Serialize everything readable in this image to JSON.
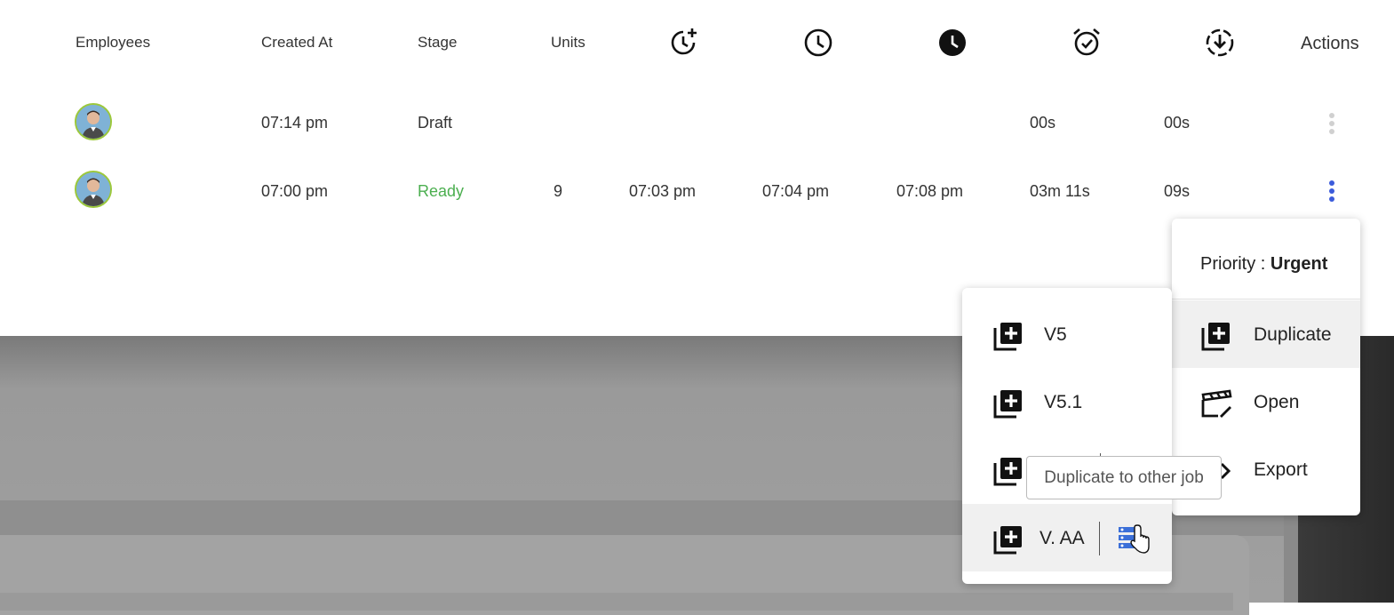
{
  "table": {
    "headers": {
      "employees": "Employees",
      "created_at": "Created At",
      "stage": "Stage",
      "units": "Units",
      "actions": "Actions"
    },
    "header_icons": [
      "clock-plus-icon",
      "clock-outline-icon",
      "clock-filled-icon",
      "alarm-clock-icon",
      "download-circle-icon"
    ],
    "rows": [
      {
        "created_at": "07:14 pm",
        "stage": "Draft",
        "units": "",
        "t1": "",
        "t2": "",
        "t3": "",
        "d1": "00s",
        "d2": "00s"
      },
      {
        "created_at": "07:00 pm",
        "stage": "Ready",
        "units": "9",
        "t1": "07:03 pm",
        "t2": "07:04 pm",
        "t3": "07:08 pm",
        "d1": "03m 11s",
        "d2": "09s"
      }
    ]
  },
  "actions_menu": {
    "priority_label": "Priority : ",
    "priority_value": "Urgent",
    "items": [
      {
        "label": "Duplicate",
        "icon": "library-add-icon"
      },
      {
        "label": "Open",
        "icon": "clapperboard-edit-icon"
      },
      {
        "label": "Export",
        "icon": "export-icon"
      }
    ]
  },
  "duplicate_submenu": {
    "items": [
      {
        "label": "V5",
        "icon": "library-add-icon"
      },
      {
        "label": "V5.1",
        "icon": "library-add-icon"
      },
      {
        "label": "",
        "icon": "library-add-icon"
      },
      {
        "label": "V. AA",
        "icon": "library-add-icon",
        "extra_icon": "job-list-icon"
      }
    ]
  },
  "tooltip": "Duplicate to other job",
  "colors": {
    "ready": "#4caf50",
    "accent": "#3b5bdb",
    "avatar_ring": "#9cc83b"
  }
}
